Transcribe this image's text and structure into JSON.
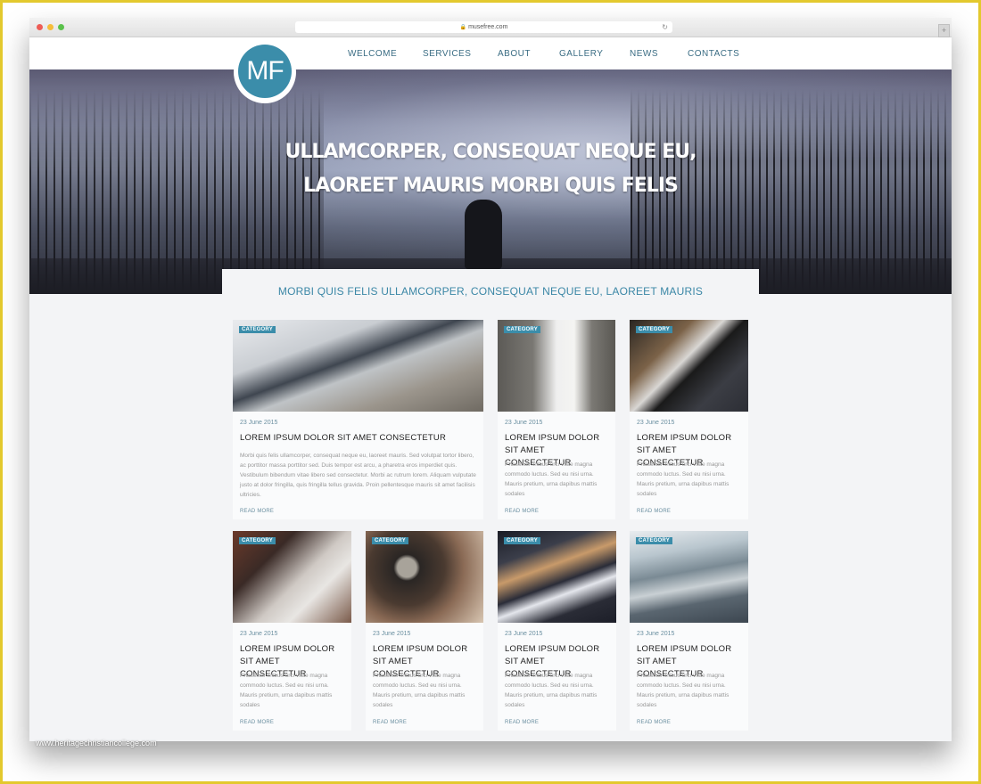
{
  "browser": {
    "url": "musefree.com",
    "lock_icon": "lock-icon",
    "reload_icon": "reload-icon",
    "new_tab_icon": "plus-icon"
  },
  "site": {
    "logo_text": "MF",
    "nav": [
      "WELCOME",
      "SERVICES",
      "ABOUT",
      "GALLERY",
      "NEWS",
      "CONTACTS"
    ],
    "hero_line1": "ULLAMCORPER, CONSEQUAT NEQUE EU,",
    "hero_line2": "LAOREET MAURIS MORBI QUIS FELIS",
    "subheading": "MORBI QUIS FELIS ULLAMCORPER, CONSEQUAT NEQUE EU, LAOREET MAURIS",
    "colors": {
      "accent": "#3b8daa",
      "nav_text": "#3b6d84"
    }
  },
  "cards": [
    {
      "category": "CATEGORY",
      "date": "23 June 2015",
      "title": "LOREM IPSUM DOLOR SIT AMET CONSECTETUR",
      "body": "Morbi quis felis ullamcorper, consequat neque eu, laoreet mauris. Sed volutpat tortor libero, ac porttitor massa porttitor sed. Duis tempor est arcu, a pharetra eros imperdiet quis. Vestibulum bibendum vitae libero sed consectetur. Morbi ac rutrum lorem. Aliquam vulputate justo at dolor fringilla, quis fringilla tellus gravida. Proin pellentesque mauris sit amet facilisis ultricies.",
      "read_more": "READ MORE",
      "image": "smartphone-photo"
    },
    {
      "category": "CATEGORY",
      "date": "23 June 2015",
      "title": "LOREM IPSUM DOLOR SIT AMET CONSECTETUR",
      "body": "Phasellus finibus orci vitae magna commodo luctus. Sed eu nisi urna. Mauris pretium, urna dapibus mattis sodales",
      "read_more": "READ MORE",
      "image": "man-against-wall-photo"
    },
    {
      "category": "CATEGORY",
      "date": "23 June 2015",
      "title": "LOREM IPSUM DOLOR SIT AMET CONSECTETUR",
      "body": "Phasellus finibus orci vitae magna commodo luctus. Sed eu nisi urna. Mauris pretium, urna dapibus mattis sodales",
      "read_more": "READ MORE",
      "image": "man-with-laptop-photo"
    },
    {
      "category": "CATEGORY",
      "date": "23 June 2015",
      "title": "LOREM IPSUM DOLOR SIT AMET CONSECTETUR",
      "body": "Phasellus finibus orci vitae magna commodo luctus. Sed eu nisi urna. Mauris pretium, urna dapibus mattis sodales",
      "read_more": "READ MORE",
      "image": "laptop-photo"
    },
    {
      "category": "CATEGORY",
      "date": "23 June 2015",
      "title": "LOREM IPSUM DOLOR SIT AMET CONSECTETUR",
      "body": "Phasellus finibus orci vitae magna commodo luctus. Sed eu nisi urna. Mauris pretium, urna dapibus mattis sodales",
      "read_more": "READ MORE",
      "image": "wristwatch-photo"
    },
    {
      "category": "CATEGORY",
      "date": "23 June 2015",
      "title": "LOREM IPSUM DOLOR SIT AMET CONSECTETUR",
      "body": "Phasellus finibus orci vitae magna commodo luctus. Sed eu nisi urna. Mauris pretium, urna dapibus mattis sodales",
      "read_more": "READ MORE",
      "image": "keyboard-photo"
    },
    {
      "category": "CATEGORY",
      "date": "23 June 2015",
      "title": "LOREM IPSUM DOLOR SIT AMET CONSECTETUR",
      "body": "Phasellus finibus orci vitae magna commodo luctus. Sed eu nisi urna. Mauris pretium, urna dapibus mattis sodales",
      "read_more": "READ MORE",
      "image": "coffee-cup-photo"
    }
  ],
  "watermark": "www.heritagechristiancollege.com"
}
